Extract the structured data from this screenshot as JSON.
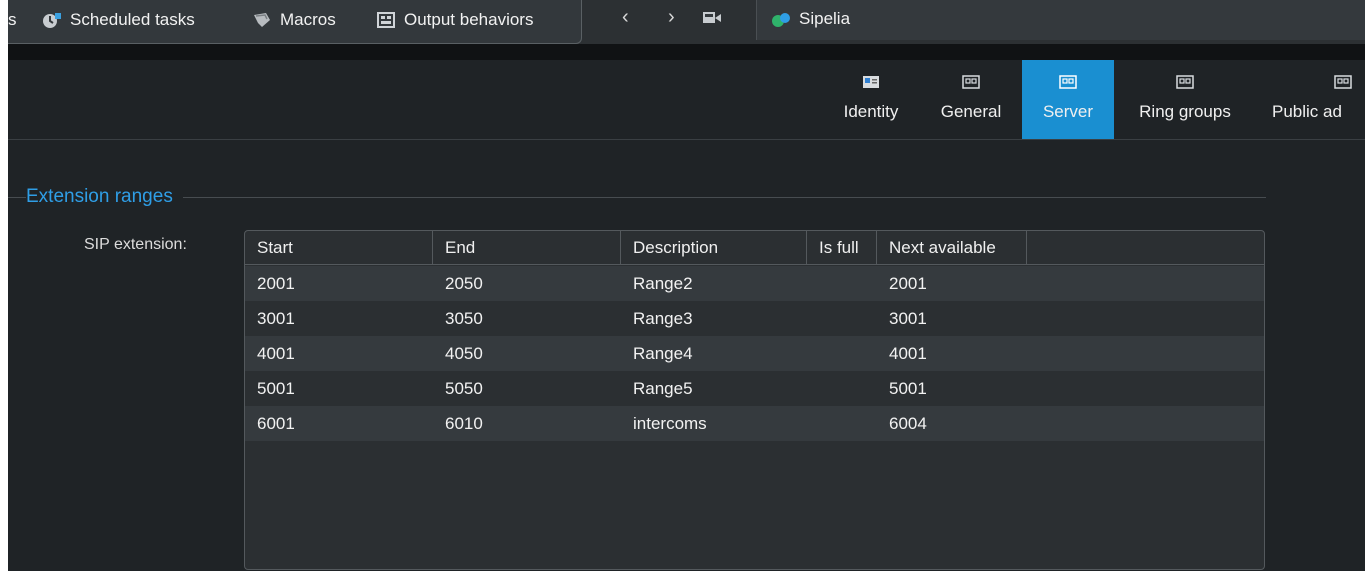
{
  "toolbar": {
    "truncated_label": "s",
    "scheduled_tasks": "Scheduled tasks",
    "macros": "Macros",
    "output_behaviors": "Output behaviors",
    "back": "‹",
    "forward": "›",
    "app_tab_title": "Sipelia"
  },
  "section_tabs": {
    "identity": "Identity",
    "general": "General",
    "server": "Server",
    "ring_groups": "Ring groups",
    "public_ad": "Public ad",
    "active": "Server"
  },
  "group": {
    "title": "Extension ranges",
    "field_label": "SIP extension:"
  },
  "table": {
    "columns": [
      "Start",
      "End",
      "Description",
      "Is full",
      "Next available"
    ],
    "rows": [
      {
        "start": "2001",
        "end": "2050",
        "description": "Range2",
        "is_full": "",
        "next": "2001"
      },
      {
        "start": "3001",
        "end": "3050",
        "description": "Range3",
        "is_full": "",
        "next": "3001"
      },
      {
        "start": "4001",
        "end": "4050",
        "description": "Range4",
        "is_full": "",
        "next": "4001"
      },
      {
        "start": "5001",
        "end": "5050",
        "description": "Range5",
        "is_full": "",
        "next": "5001"
      },
      {
        "start": "6001",
        "end": "6010",
        "description": "intercoms",
        "is_full": "",
        "next": "6004"
      }
    ]
  },
  "colors": {
    "accent": "#1a8fd1",
    "group_title": "#2f9ee6",
    "background": "#1f2326"
  }
}
